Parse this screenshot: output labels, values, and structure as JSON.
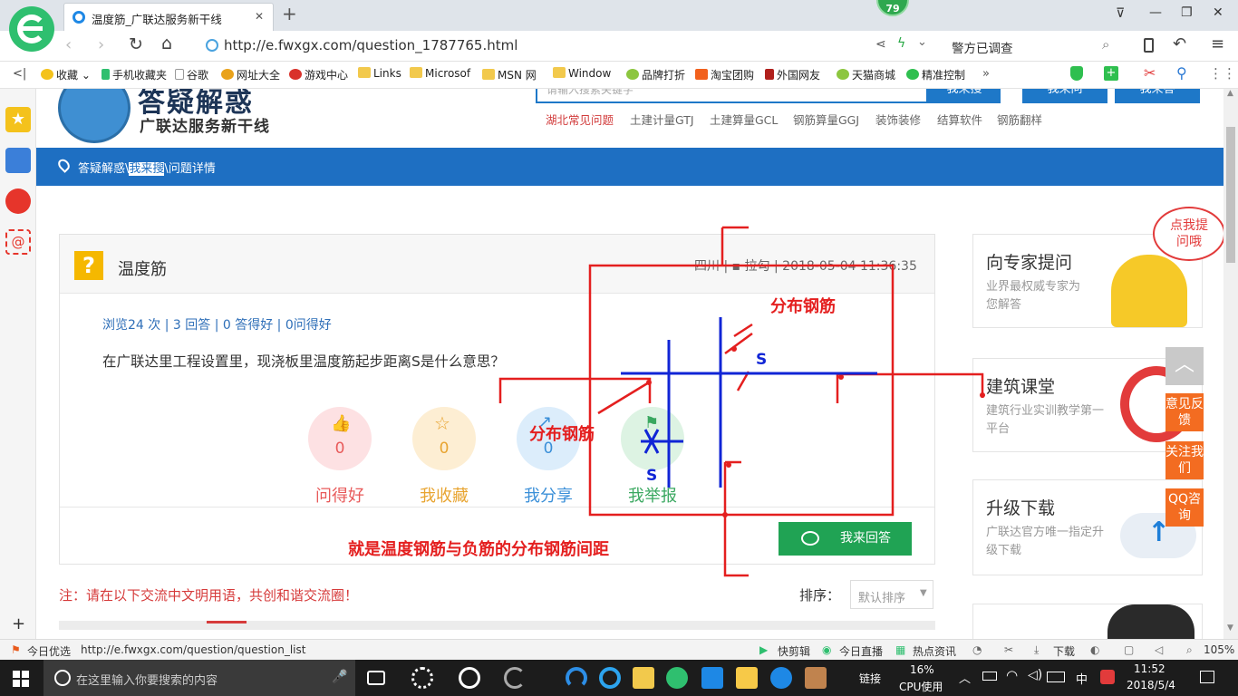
{
  "browser": {
    "tab_title": "温度筋_广联达服务新干线",
    "notification_count": "79",
    "url": "http://e.fwxgx.com/question_1787765.html",
    "search_box_text": "警方已调查",
    "new_tab_symbol": "+",
    "close_symbol": "✕",
    "window_controls": {
      "pin": "⊽",
      "minimize": "—",
      "maximize": "❐",
      "close": "✕"
    }
  },
  "bookmarks": [
    {
      "label": "收藏",
      "icon": "star-icon"
    },
    {
      "label": "手机收藏夹",
      "icon": "phone-icon"
    },
    {
      "label": "谷歌",
      "icon": "page-icon"
    },
    {
      "label": "网址大全",
      "icon": "globe-icon"
    },
    {
      "label": "游戏中心",
      "icon": "game-icon"
    },
    {
      "label": "Links",
      "icon": "folder-icon"
    },
    {
      "label": "Microsof",
      "icon": "folder-icon"
    },
    {
      "label": "MSN 网",
      "icon": "folder-icon"
    },
    {
      "label": "Window",
      "icon": "folder-icon"
    },
    {
      "label": "品牌打折",
      "icon": "leaf-icon"
    },
    {
      "label": "淘宝团购",
      "icon": "taobao-icon"
    },
    {
      "label": "外国网友",
      "icon": "flag-icon"
    },
    {
      "label": "天猫商城",
      "icon": "leaf-icon"
    },
    {
      "label": "精准控制",
      "icon": "wechat-icon"
    }
  ],
  "site": {
    "logo_line1": "答疑解惑",
    "logo_line2": "广联达服务新干线",
    "search_placeholder": "请输入搜索关键字",
    "search_btn1": "我来搜",
    "search_btn2": "我来问",
    "search_btn3": "我来答",
    "quick_links": [
      "湖北常见问题",
      "土建计量GTJ",
      "土建算量GCL",
      "钢筋算量GGJ",
      "装饰装修",
      "结算软件",
      "钢筋翻样"
    ],
    "breadcrumb": {
      "home": "答疑解惑",
      "sep1": "\\",
      "mid": "我来搜",
      "sep2": "\\",
      "current": "问题详情"
    }
  },
  "question": {
    "icon_glyph": "?",
    "title": "温度筋",
    "meta": "四川 | ▪ 拉勾 | 2018-05-04 11:36:35",
    "stats": "浏览24 次 | 3 回答 | 0 答得好 | 0问得好",
    "body": "在广联达里工程设置里，现浇板里温度筋起步距离S是什么意思？",
    "actions": [
      {
        "label": "问得好",
        "count": "0",
        "color": "#e85a5a",
        "bg": "#fde1e3",
        "icon": "thumbs-up-icon"
      },
      {
        "label": "我收藏",
        "count": "0",
        "color": "#e8a430",
        "bg": "#fdeed3",
        "icon": "star-outline-icon"
      },
      {
        "label": "我分享",
        "count": "0",
        "color": "#3a8fd8",
        "bg": "#dcedfb",
        "icon": "share-icon"
      },
      {
        "label": "我举报",
        "count": "0",
        "color": "#3aa860",
        "bg": "#ddf3e3",
        "icon": "report-icon"
      }
    ],
    "answer_button": "我来回答"
  },
  "notice": "注：请在以下交流中文明用语，共创和谐交流圈！",
  "sort": {
    "label": "排序：",
    "value": "默认排序"
  },
  "annotations": {
    "label_top": "分布钢筋",
    "label_left": "分布钢筋",
    "s_top": "S",
    "s_bottom": "S",
    "caption": "就是温度钢筋与负筋的分布钢筋间距"
  },
  "sidebar_right": {
    "cards": [
      {
        "title": "向专家提问",
        "sub": "业界最权威专家为您解答"
      },
      {
        "title": "建筑课堂",
        "sub": "建筑行业实训教学第一平台"
      },
      {
        "title": "升级下载",
        "sub": "广联达官方唯一指定升级下载"
      }
    ],
    "bubble": "点我提问哦",
    "float_buttons": [
      "意见反馈",
      "关注我们",
      "QQ咨询"
    ]
  },
  "statusbar": {
    "left": "今日优选",
    "url": "http://e.fwxgx.com/question/question_list",
    "items": [
      "快剪辑",
      "今日直播",
      "热点资讯",
      "下载"
    ],
    "zoom": "105%"
  },
  "taskbar": {
    "search_placeholder": "在这里输入你要搜索的内容",
    "link_label": "链接",
    "cpu_value": "16%",
    "cpu_label": "CPU使用",
    "ime": "中",
    "time": "11:52",
    "date": "2018/5/4"
  }
}
